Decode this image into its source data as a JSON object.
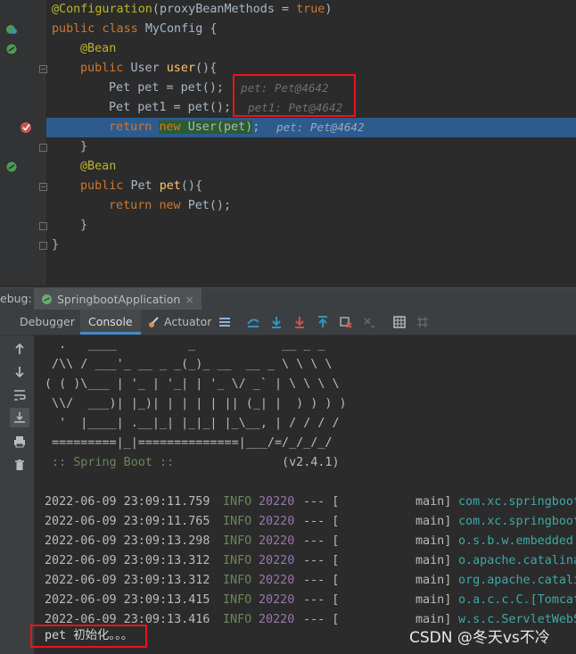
{
  "editor": {
    "lines": [
      {
        "ann": "@Configuration",
        "rest_open": "(",
        "param": "proxyBeanMethods",
        "eq": " = ",
        "val": "true",
        "close": ")"
      },
      {
        "kw1": "public ",
        "kw2": "class ",
        "name": "MyConfig {"
      },
      {
        "ann": "@Bean"
      },
      {
        "kw": "public ",
        "type": "User ",
        "fn": "user",
        "rest": "(){"
      },
      {
        "code": "Pet pet = pet();",
        "inlay": "pet: Pet@4642"
      },
      {
        "code": "Pet pet1 = pet();",
        "inlay": "pet1: Pet@4642"
      },
      {
        "kw": "return ",
        "kw2": "new ",
        "code": "User(pet)",
        "semi": ";",
        "inlay": "pet: Pet@4642"
      },
      {
        "code": "}"
      },
      {
        "ann": "@Bean"
      },
      {
        "kw": "public ",
        "type": "Pet ",
        "fn": "pet",
        "rest": "(){"
      },
      {
        "kw": "return ",
        "kw2": "new ",
        "code": "Pet();"
      },
      {
        "code": "}"
      },
      {
        "code": "}"
      }
    ]
  },
  "debug": {
    "label": "ebug:",
    "run_tab": "SpringbootApplication",
    "close_glyph": "×"
  },
  "tabs": {
    "debugger": "Debugger",
    "console": "Console",
    "actuator": "Actuator"
  },
  "banner": [
    "  .   ____          _            __ _ _",
    " /\\\\ / ___'_ __ _ _(_)_ __  __ _ \\ \\ \\ \\",
    "( ( )\\___ | '_ | '_| | '_ \\/ _` | \\ \\ \\ \\",
    " \\\\/  ___)| |_)| | | | | || (_| |  ) ) ) )",
    "  '  |____| .__|_| |_|_| |_\\__, | / / / /",
    " =========|_|==============|___/=/_/_/_/"
  ],
  "boot": {
    "label": " :: Spring Boot ::",
    "version": "(v2.4.1)"
  },
  "logs": [
    {
      "ts": "2022-06-09 23:09:11.759",
      "level": "INFO",
      "pid": "20220",
      "sep": "--- [",
      "thread": "main]",
      "cls": "com.xc.springboot"
    },
    {
      "ts": "2022-06-09 23:09:11.765",
      "level": "INFO",
      "pid": "20220",
      "sep": "--- [",
      "thread": "main]",
      "cls": "com.xc.springboot"
    },
    {
      "ts": "2022-06-09 23:09:13.298",
      "level": "INFO",
      "pid": "20220",
      "sep": "--- [",
      "thread": "main]",
      "cls": "o.s.b.w.embedded."
    },
    {
      "ts": "2022-06-09 23:09:13.312",
      "level": "INFO",
      "pid": "20220",
      "sep": "--- [",
      "thread": "main]",
      "cls": "o.apache.catalina"
    },
    {
      "ts": "2022-06-09 23:09:13.312",
      "level": "INFO",
      "pid": "20220",
      "sep": "--- [",
      "thread": "main]",
      "cls": "org.apache.catali"
    },
    {
      "ts": "2022-06-09 23:09:13.415",
      "level": "INFO",
      "pid": "20220",
      "sep": "--- [",
      "thread": "main]",
      "cls": "o.a.c.c.C.[Tomcat"
    },
    {
      "ts": "2022-06-09 23:09:13.416",
      "level": "INFO",
      "pid": "20220",
      "sep": "--- [",
      "thread": "main]",
      "cls": "w.s.c.ServletWebS"
    }
  ],
  "output": "pet 初始化。。。",
  "watermark": "CSDN @冬天vs不冷",
  "colors": {
    "accent": "#4a88c7",
    "highlight": "#2d5b8e",
    "annotation_box": "#e8141c"
  }
}
